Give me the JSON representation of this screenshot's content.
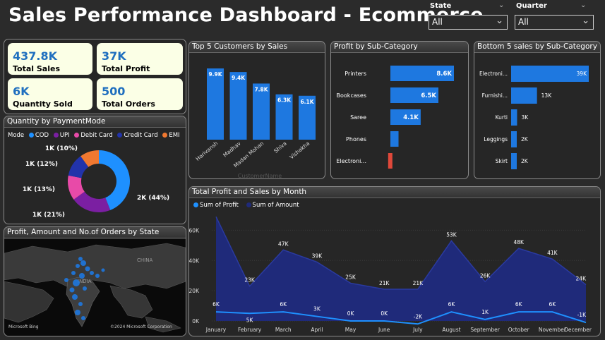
{
  "title": "Sales Performance Dashboard - Ecommerce",
  "filters": [
    {
      "label": "State",
      "value": "All"
    },
    {
      "label": "Quarter",
      "value": "All"
    }
  ],
  "kpis": [
    {
      "value": "437.8K",
      "label": "Total Sales"
    },
    {
      "value": "37K",
      "label": "Total Profit"
    },
    {
      "value": "6K",
      "label": "Quantity Sold"
    },
    {
      "value": "500",
      "label": "Total Orders"
    }
  ],
  "colors": {
    "bar": "#1e78e0",
    "negative": "#e0483a",
    "area": "#1f2a7a",
    "profit_line": "#1e90ff",
    "card_bg": "#fbffe6"
  },
  "panels": {
    "payment_title": "Quantity by PaymentMode",
    "customers_title": "Top 5 Customers by Sales",
    "profit_subcat_title": "Profit by Sub-Category",
    "bottom5_title": "Bottom 5 sales by Sub-Category",
    "monthly_title": "Total Profit and Sales by Month",
    "map_title": "Profit, Amount and No.of Orders by State"
  },
  "map": {
    "labels": [
      "CHINA",
      "INDIA"
    ],
    "attribution": "Microsoft Bing",
    "copyright": "©2024 Microsoft Corporation"
  },
  "chart_data": [
    {
      "type": "pie",
      "variant": "donut",
      "legend_title": "Mode",
      "categories": [
        "COD",
        "UPI",
        "Debit Card",
        "Credit Card",
        "EMI"
      ],
      "values": [
        2000,
        1000,
        1000,
        1000,
        1000
      ],
      "data_labels": [
        "2K (44%)",
        "1K (21%)",
        "1K (13%)",
        "1K (12%)",
        "1K (10%)"
      ],
      "percent": [
        44,
        21,
        13,
        12,
        10
      ],
      "colors": [
        "#1e90ff",
        "#7b1fa2",
        "#e84aa8",
        "#2233aa",
        "#f07830"
      ]
    },
    {
      "type": "bar",
      "title": "Top 5 Customers by Sales",
      "xlabel": "CustomerName",
      "categories": [
        "Harivansh",
        "Madhav",
        "Madan Mohan",
        "Shiva",
        "Vishakha"
      ],
      "values": [
        9.9,
        9.4,
        7.8,
        6.3,
        6.1
      ],
      "data_labels": [
        "9.9K",
        "9.4K",
        "7.8K",
        "6.3K",
        "6.1K"
      ]
    },
    {
      "type": "bar",
      "orientation": "horizontal",
      "title": "Profit by Sub-Category",
      "categories": [
        "Printers",
        "Bookcases",
        "Saree",
        "Phones",
        "Electroni..."
      ],
      "values": [
        8.6,
        6.5,
        4.1,
        1.1,
        -0.4
      ],
      "data_labels": [
        "8.6K",
        "6.5K",
        "4.1K",
        "",
        ""
      ]
    },
    {
      "type": "bar",
      "orientation": "horizontal",
      "title": "Bottom 5 sales by Sub-Category",
      "categories": [
        "Electroni...",
        "Furnishi...",
        "Kurti",
        "Leggings",
        "Skirt"
      ],
      "values": [
        39,
        13,
        3,
        2,
        2
      ],
      "data_labels": [
        "39K",
        "13K",
        "3K",
        "2K",
        "2K"
      ]
    },
    {
      "type": "area",
      "title": "Total Profit and Sales by Month",
      "categories": [
        "January",
        "February",
        "March",
        "April",
        "May",
        "June",
        "July",
        "August",
        "September",
        "October",
        "November",
        "December"
      ],
      "series": [
        {
          "name": "Sum of Profit",
          "values": [
            6,
            5,
            6,
            3,
            0,
            0,
            -2,
            6,
            1,
            6,
            6,
            -1
          ],
          "labels": [
            "6K",
            "5K",
            "6K",
            "3K",
            "0K",
            "0K",
            "-2K",
            "6K",
            "1K",
            "6K",
            "6K",
            "-1K"
          ]
        },
        {
          "name": "Sum of Amount",
          "values": [
            69,
            23,
            47,
            39,
            25,
            21,
            21,
            53,
            26,
            48,
            41,
            24
          ],
          "labels": [
            "69K",
            "23K",
            "47K",
            "39K",
            "25K",
            "21K",
            "21K",
            "53K",
            "26K",
            "48K",
            "41K",
            "24K"
          ]
        }
      ],
      "yticks": [
        "0K",
        "20K",
        "40K",
        "60K"
      ],
      "ylim": [
        0,
        70
      ]
    }
  ]
}
